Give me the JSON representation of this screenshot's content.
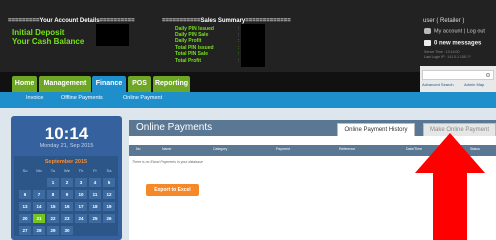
{
  "header": {
    "account_title": "=========Your Account Details==========",
    "account_labels": [
      "Initial Deposit",
      "Your Cash Balance"
    ],
    "sales_title": "===========Sales Summary=============",
    "sales_labels": [
      "Daily PIN Issued",
      "Daily PIN Sale",
      "Daily Profit",
      "Total PIN Issued",
      "Total PIN Sale",
      "Total Profit"
    ],
    "sales_colon": ":",
    "user_role": "user ( Retailer )",
    "links": "My account | Log out",
    "messages": "0 new messages",
    "server_time": "Server Time : 10:14:00",
    "last_login": "Last Login IP : 141.0.1.155.??"
  },
  "nav": {
    "tabs": [
      "Home",
      "Management",
      "Finance",
      "POS",
      "Reporting"
    ],
    "active_tab": "Finance",
    "search_links": [
      "Advanced Search",
      "Admin Map"
    ]
  },
  "subnav": {
    "items": [
      "Invoice",
      "Offline Payments",
      "Online Payment"
    ]
  },
  "clock": {
    "time": "10:14",
    "date": "Monday 21, Sep 2015"
  },
  "calendar": {
    "title": "September 2015",
    "dow": [
      "Su",
      "Mo",
      "Tu",
      "We",
      "Th",
      "Fr",
      "Sa"
    ],
    "weeks": [
      [
        "",
        "",
        "1",
        "2",
        "3",
        "4",
        "5"
      ],
      [
        "6",
        "7",
        "8",
        "9",
        "10",
        "11",
        "12"
      ],
      [
        "13",
        "14",
        "15",
        "16",
        "17",
        "18",
        "19"
      ],
      [
        "20",
        "21",
        "22",
        "23",
        "24",
        "25",
        "26"
      ],
      [
        "27",
        "28",
        "29",
        "30",
        "",
        "",
        ""
      ]
    ],
    "today": "21"
  },
  "panel": {
    "title": "Online Payments",
    "tabs": [
      "Online Payment History",
      "Make Online Payment"
    ],
    "columns": [
      "No",
      "Name",
      "Category",
      "Payment",
      "Reference",
      "Date/Time",
      "Status"
    ],
    "empty_message": "There is no Ebost Payments in your database",
    "export_label": "Export to Excel"
  },
  "colors": {
    "accent_green": "#76e019",
    "nav_green": "#6ea626",
    "nav_blue": "#1f8fcc",
    "arrow_red": "#ff0000"
  }
}
